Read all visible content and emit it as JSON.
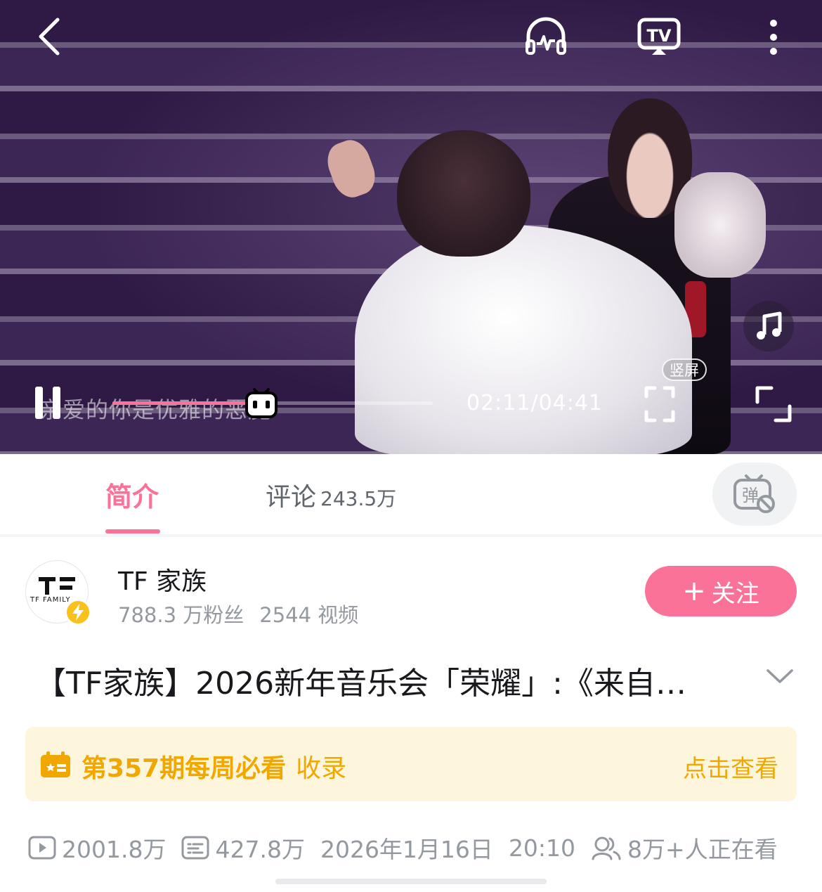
{
  "player": {
    "subtitle": "亲爱的你是优雅的恶魔",
    "time": "02:11/04:41",
    "progress_fraction": 0.466,
    "portrait_label": "竖屏"
  },
  "icons": {
    "back": "back-chevron-icon",
    "listen": "headphones-icon",
    "cast": "tv-cast-icon",
    "more": "more-vertical-icon",
    "music": "music-note-icon",
    "pause": "pause-icon",
    "thumb": "bilibili-tv-icon",
    "fullscreen": "fullscreen-icon",
    "rotate": "rotate-screen-icon",
    "danmaku": "danmaku-off-icon"
  },
  "tabs": {
    "intro": "简介",
    "comments": "评论",
    "comment_count": "243.5万"
  },
  "uploader": {
    "name": "TF 家族",
    "avatar_text": "TF FAMILY",
    "fans": "788.3 万粉丝",
    "videos": "2544 视频",
    "follow_label": "关注",
    "follow_plus": "+"
  },
  "video": {
    "title": "【TF家族】2026新年音乐会「荣耀」:《来自…"
  },
  "collection": {
    "title": "第357期每周必看",
    "suffix": "收录",
    "action": "点击查看"
  },
  "stats": {
    "plays": "2001.8万",
    "danmaku": "427.8万",
    "date": "2026年1月16日",
    "time": "20:10",
    "watching": "8万+人正在看"
  },
  "colors": {
    "accent": "#fb7299",
    "gold": "#f0a800"
  }
}
